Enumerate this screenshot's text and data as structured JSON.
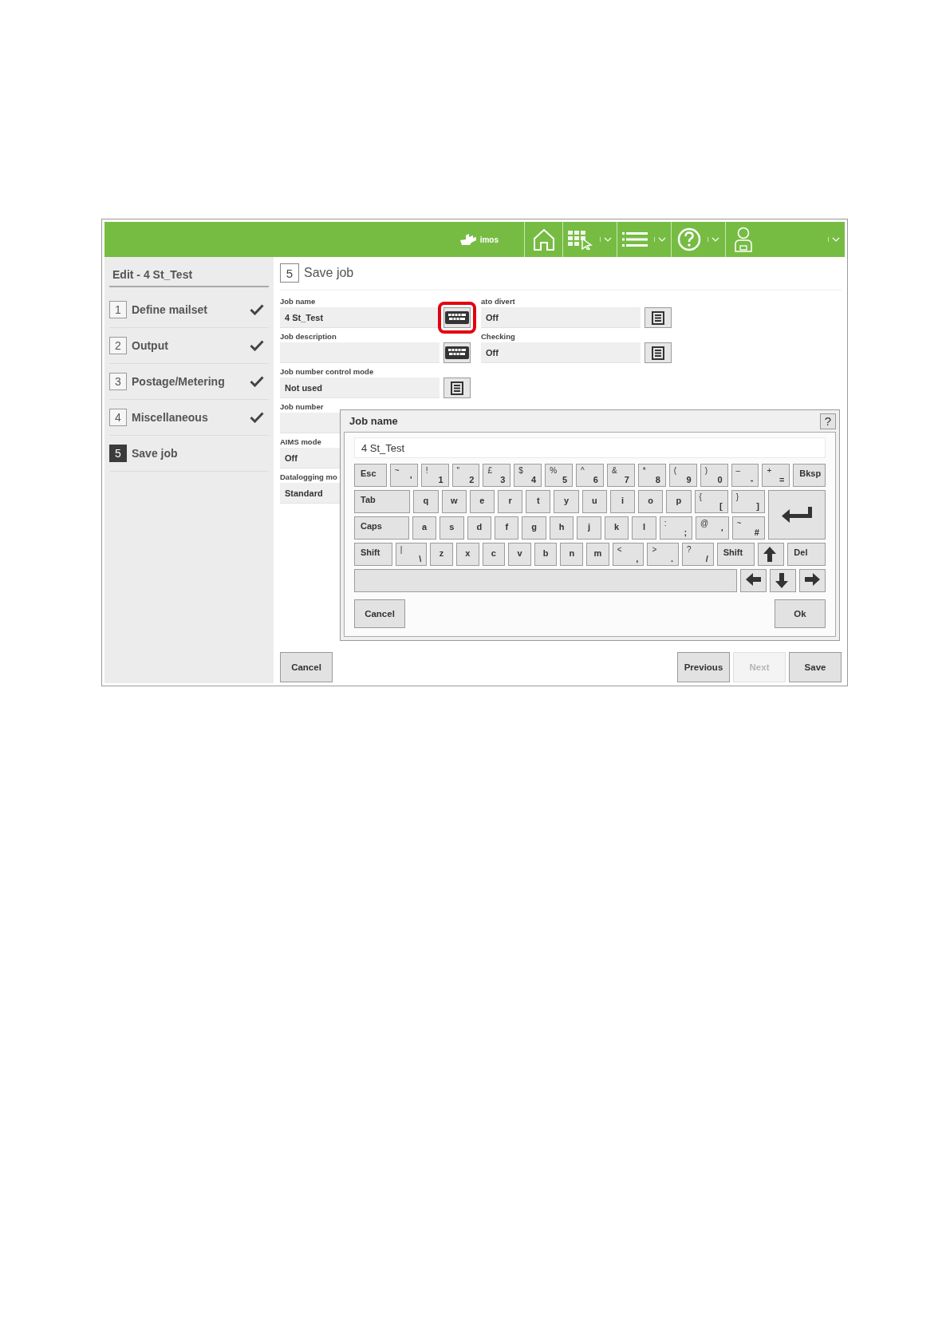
{
  "top_bar": {
    "brand": "imos"
  },
  "sidebar": {
    "title": "Edit - 4 St_Test",
    "steps": [
      {
        "number": "1",
        "label": "Define mailset",
        "completed": true,
        "selected": false
      },
      {
        "number": "2",
        "label": "Output",
        "completed": true,
        "selected": false
      },
      {
        "number": "3",
        "label": "Postage/Metering",
        "completed": true,
        "selected": false
      },
      {
        "number": "4",
        "label": "Miscellaneous",
        "completed": true,
        "selected": false
      },
      {
        "number": "5",
        "label": "Save job",
        "completed": false,
        "selected": true
      }
    ]
  },
  "page": {
    "number": "5",
    "title": "Save job"
  },
  "fields_left": [
    {
      "label": "Job name",
      "value": "4 St_Test",
      "kind": "text",
      "highlighted": true
    },
    {
      "label": "Job description",
      "kind": "text"
    },
    {
      "label": "Job number control mode",
      "value": "Not used",
      "kind": "list"
    },
    {
      "label": "Job number"
    },
    {
      "label": "AIMS mode",
      "value": "Off"
    },
    {
      "label": "Datalogging mo",
      "value": "Standard"
    }
  ],
  "fields_right": [
    {
      "label": "ato divert",
      "value": "Off",
      "kind": "list"
    },
    {
      "label": "Checking",
      "value": "Off",
      "kind": "list"
    }
  ],
  "dialog": {
    "title": "Job name",
    "help": "?",
    "value": "4 St_Test",
    "keyboard": [
      {
        "keys": [
          {
            "kind": "named",
            "label": "Esc"
          },
          {
            "kind": "char",
            "shift": "~",
            "label": "'"
          },
          {
            "kind": "char",
            "shift": "!",
            "label": "1"
          },
          {
            "kind": "char",
            "shift": "\"",
            "label": "2"
          },
          {
            "kind": "char",
            "shift": "£",
            "label": "3"
          },
          {
            "kind": "char",
            "shift": "$",
            "label": "4"
          },
          {
            "kind": "char",
            "shift": "%",
            "label": "5"
          },
          {
            "kind": "char",
            "shift": "^",
            "label": "6"
          },
          {
            "kind": "char",
            "shift": "&",
            "label": "7"
          },
          {
            "kind": "char",
            "shift": "*",
            "label": "8"
          },
          {
            "kind": "char",
            "shift": "(",
            "label": "9"
          },
          {
            "kind": "char",
            "shift": ")",
            "label": "0"
          },
          {
            "kind": "char",
            "shift": "–",
            "label": "-"
          },
          {
            "kind": "char",
            "shift": "+",
            "label": "="
          },
          {
            "kind": "named",
            "label": "Bksp"
          }
        ]
      },
      {
        "keys": [
          {
            "kind": "named",
            "label": "Tab"
          },
          {
            "kind": "letter",
            "label": "q"
          },
          {
            "kind": "letter",
            "label": "w"
          },
          {
            "kind": "letter",
            "label": "e"
          },
          {
            "kind": "letter",
            "label": "r"
          },
          {
            "kind": "letter",
            "label": "t"
          },
          {
            "kind": "letter",
            "label": "y"
          },
          {
            "kind": "letter",
            "label": "u"
          },
          {
            "kind": "letter",
            "label": "i"
          },
          {
            "kind": "letter",
            "label": "o"
          },
          {
            "kind": "letter",
            "label": "p"
          },
          {
            "kind": "char",
            "shift": "{",
            "label": "["
          },
          {
            "kind": "char",
            "shift": "}",
            "label": "]"
          },
          {
            "kind": "enter"
          }
        ]
      },
      {
        "keys": [
          {
            "kind": "named",
            "label": "Caps"
          },
          {
            "kind": "letter",
            "label": "a"
          },
          {
            "kind": "letter",
            "label": "s"
          },
          {
            "kind": "letter",
            "label": "d"
          },
          {
            "kind": "letter",
            "label": "f"
          },
          {
            "kind": "letter",
            "label": "g"
          },
          {
            "kind": "letter",
            "label": "h"
          },
          {
            "kind": "letter",
            "label": "j"
          },
          {
            "kind": "letter",
            "label": "k"
          },
          {
            "kind": "letter",
            "label": "l"
          },
          {
            "kind": "char",
            "shift": ":",
            "label": ";"
          },
          {
            "kind": "char",
            "shift": "@",
            "label": "'"
          },
          {
            "kind": "char",
            "shift": "~",
            "label": "#"
          }
        ]
      },
      {
        "keys": [
          {
            "kind": "named",
            "label": "Shift"
          },
          {
            "kind": "char",
            "shift": "|",
            "label": "\\"
          },
          {
            "kind": "letter",
            "label": "z"
          },
          {
            "kind": "letter",
            "label": "x"
          },
          {
            "kind": "letter",
            "label": "c"
          },
          {
            "kind": "letter",
            "label": "v"
          },
          {
            "kind": "letter",
            "label": "b"
          },
          {
            "kind": "letter",
            "label": "n"
          },
          {
            "kind": "letter",
            "label": "m"
          },
          {
            "kind": "char",
            "shift": "<",
            "label": ","
          },
          {
            "kind": "char",
            "shift": ">",
            "label": "."
          },
          {
            "kind": "char",
            "shift": "?",
            "label": "/"
          },
          {
            "kind": "named",
            "label": "Shift"
          },
          {
            "kind": "up"
          },
          {
            "kind": "named",
            "label": "Del"
          }
        ]
      },
      {
        "keys": [
          {
            "kind": "space"
          },
          {
            "kind": "left"
          },
          {
            "kind": "down"
          },
          {
            "kind": "right"
          }
        ]
      }
    ],
    "buttons": [
      "Cancel",
      "Ok"
    ]
  },
  "footer": {
    "buttons": [
      {
        "label": "Cancel",
        "disabled": false
      },
      {
        "label": "Previous",
        "disabled": false
      },
      {
        "label": "Next",
        "disabled": true
      },
      {
        "label": "Save",
        "disabled": false
      }
    ]
  }
}
